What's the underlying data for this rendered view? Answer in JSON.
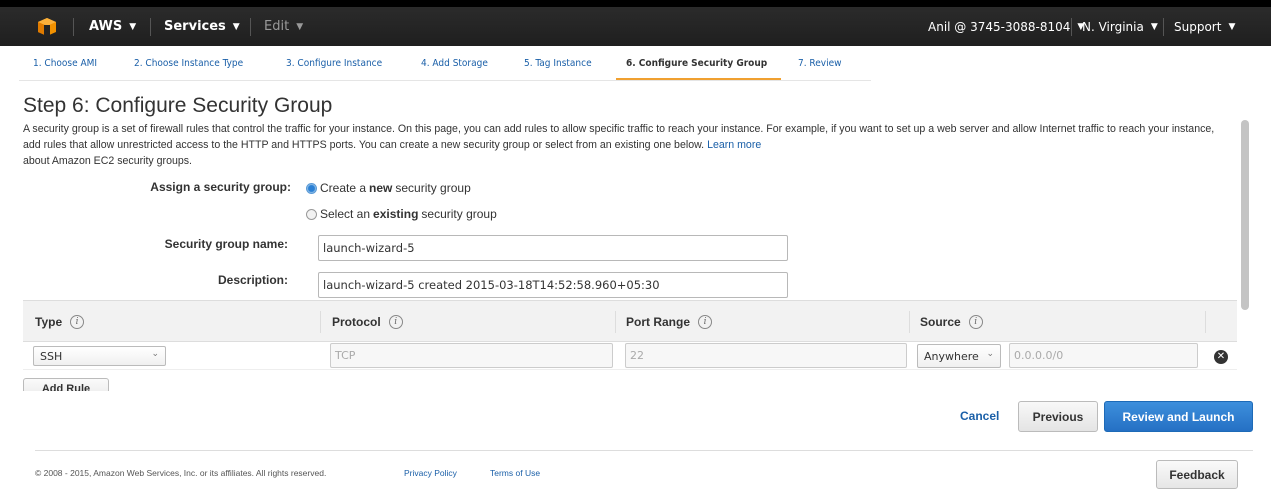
{
  "nav": {
    "logo_icon": "aws-cube-icon",
    "aws_label": "AWS",
    "services_label": "Services",
    "edit_label": "Edit",
    "account_label": "Anil @ 3745-3088-8104",
    "region_label": "N. Virginia",
    "support_label": "Support",
    "caret": "▼"
  },
  "tabs": [
    {
      "label": "1. Choose AMI"
    },
    {
      "label": "2. Choose Instance Type"
    },
    {
      "label": "3. Configure Instance"
    },
    {
      "label": "4. Add Storage"
    },
    {
      "label": "5. Tag Instance"
    },
    {
      "label": "6. Configure Security Group",
      "active": true
    },
    {
      "label": "7. Review"
    }
  ],
  "page": {
    "title": "Step 6: Configure Security Group",
    "intro_text": "A security group is a set of firewall rules that control the traffic for your instance. On this page, you can add rules to allow specific traffic to reach your instance. For example, if you want to set up a web server and allow Internet traffic to reach your instance, add rules that allow unrestricted access to the HTTP and HTTPS ports. You can create a new security group or select from an existing one below.",
    "learn_more": "Learn more",
    "intro_tail": "about Amazon EC2 security groups."
  },
  "form": {
    "assign_label": "Assign a security group:",
    "option_new_pre": "Create a",
    "option_new_bold": "new",
    "option_new_post": "security group",
    "option_existing_pre": "Select an",
    "option_existing_bold": "existing",
    "option_existing_post": "security group",
    "selected_option": "new",
    "name_label": "Security group name:",
    "name_value": "launch-wizard-5",
    "desc_label": "Description:",
    "desc_value": "launch-wizard-5 created 2015-03-18T14:52:58.960+05:30"
  },
  "rules": {
    "headers": {
      "type": "Type",
      "protocol": "Protocol",
      "port_range": "Port Range",
      "source": "Source"
    },
    "info_glyph": "i",
    "rows": [
      {
        "type": "SSH",
        "protocol": "TCP",
        "port_range": "22",
        "source_select": "Anywhere",
        "source_cidr": "0.0.0.0/0"
      }
    ],
    "add_rule_label": "Add Rule",
    "delete_glyph": "✕"
  },
  "actions": {
    "cancel_label": "Cancel",
    "previous_label": "Previous",
    "launch_label": "Review and Launch"
  },
  "footer": {
    "copyright": "© 2008 - 2015, Amazon Web Services, Inc. or its affiliates. All rights reserved.",
    "privacy": "Privacy Policy",
    "terms": "Terms of Use",
    "feedback_label": "Feedback"
  },
  "colors": {
    "nav_bg": "#232323",
    "link": "#1a5fa8",
    "tab_active_underline": "#f0a030",
    "primary_button": "#2570c4",
    "logo_orange": "#f29100"
  }
}
